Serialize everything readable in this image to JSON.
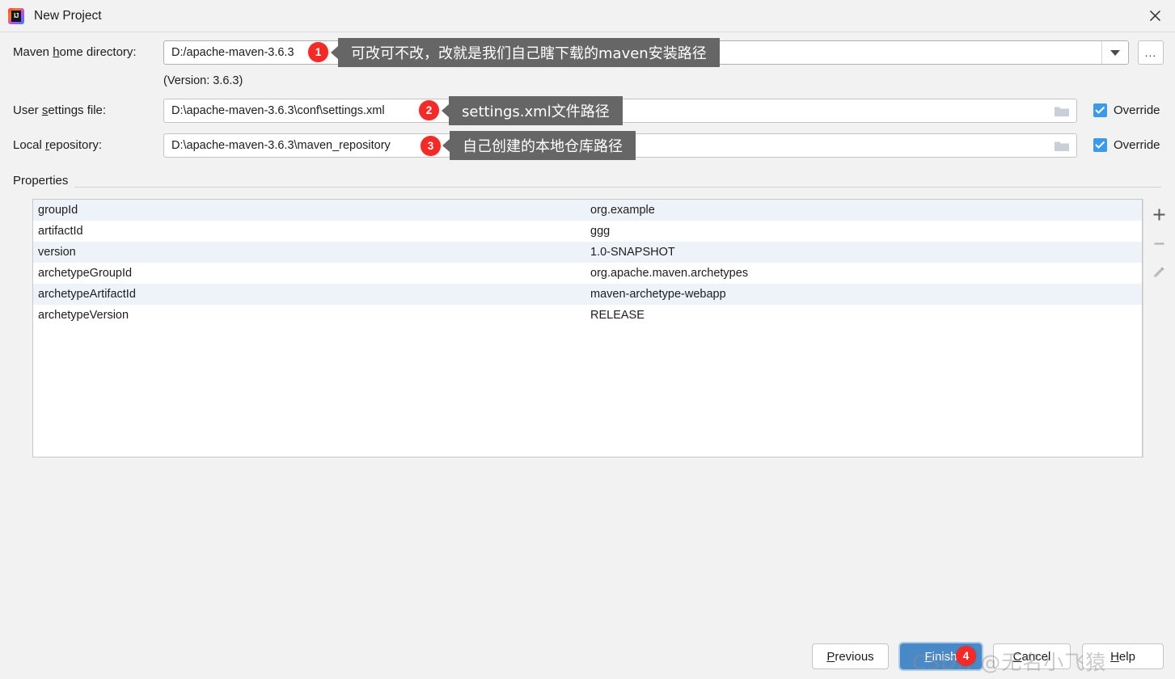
{
  "window": {
    "title": "New Project",
    "logo_icon": "intellij-idea-logo",
    "close_icon": "close-icon"
  },
  "form": {
    "maven_home": {
      "label_pre": "Maven ",
      "label_mn": "h",
      "label_post": "ome directory:",
      "value": "D:/apache-maven-3.6.3",
      "dropdown_icon": "chevron-down-icon",
      "browse_label": "...",
      "version_note": "(Version: 3.6.3)"
    },
    "user_settings": {
      "label_pre": "User ",
      "label_mn": "s",
      "label_post": "ettings file:",
      "value": "D:\\apache-maven-3.6.3\\conf\\settings.xml",
      "folder_icon": "folder-icon",
      "override_label": "Override",
      "override_checked": true
    },
    "local_repository": {
      "label_pre": "Local ",
      "label_mn": "r",
      "label_post": "epository:",
      "value": "D:\\apache-maven-3.6.3\\maven_repository",
      "folder_icon": "folder-icon",
      "override_label": "Override",
      "override_checked": true
    }
  },
  "properties": {
    "section_title": "Properties",
    "rows": [
      {
        "key": "groupId",
        "value": "org.example"
      },
      {
        "key": "artifactId",
        "value": "ggg"
      },
      {
        "key": "version",
        "value": "1.0-SNAPSHOT"
      },
      {
        "key": "archetypeGroupId",
        "value": "org.apache.maven.archetypes"
      },
      {
        "key": "archetypeArtifactId",
        "value": "maven-archetype-webapp"
      },
      {
        "key": "archetypeVersion",
        "value": "RELEASE"
      }
    ],
    "tools": [
      {
        "name": "add-property-button",
        "icon": "plus-icon"
      },
      {
        "name": "remove-property-button",
        "icon": "minus-icon"
      },
      {
        "name": "edit-property-button",
        "icon": "pencil-icon"
      }
    ]
  },
  "annotations": [
    {
      "number": "1",
      "text": "可改可不改，改就是我们自己瞎下载的maven安装路径"
    },
    {
      "number": "2",
      "text": "settings.xml文件路径"
    },
    {
      "number": "3",
      "text": "自己创建的本地仓库路径"
    },
    {
      "number": "4",
      "text": ""
    }
  ],
  "footer": {
    "previous": {
      "pre": "",
      "mn": "P",
      "post": "revious"
    },
    "finish": {
      "pre": "",
      "mn": "F",
      "post": "inish"
    },
    "cancel": {
      "pre": "",
      "mn": "C",
      "post": "ancel"
    },
    "help": {
      "pre": "",
      "mn": "H",
      "post": "elp"
    }
  },
  "watermark": "CSDN @无名小飞猿",
  "colors": {
    "accent": "#4a89c8",
    "badge": "#f22a28",
    "tooltip": "#666666",
    "checkbox": "#3d9ae8",
    "row_alt": "#eef2f9"
  }
}
